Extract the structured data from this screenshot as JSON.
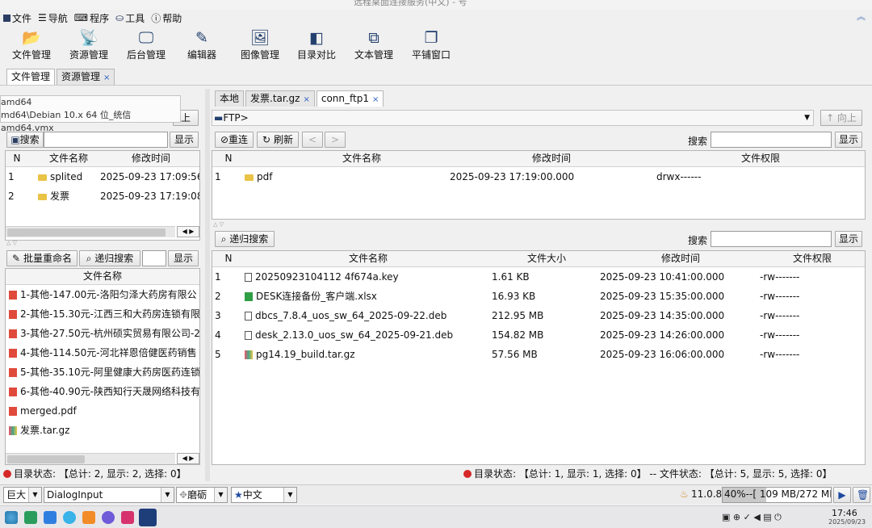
{
  "window": {
    "title": "远程桌面连接服务(中文) - 号"
  },
  "menu": [
    {
      "label": "文件",
      "icon": "document-icon"
    },
    {
      "label": "导航",
      "icon": "menu-lines-icon"
    },
    {
      "label": "程序",
      "icon": "keyboard-icon"
    },
    {
      "label": "工具",
      "icon": "toolbox-icon"
    },
    {
      "label": "帮助",
      "icon": "help-icon"
    }
  ],
  "toolbar": [
    {
      "label": "文件管理",
      "icon": "folder-open-icon"
    },
    {
      "label": "资源管理",
      "icon": "satellite-icon"
    },
    {
      "label": "后台管理",
      "icon": "monitor-icon"
    },
    {
      "label": "编辑器",
      "icon": "edit-icon"
    },
    {
      "label": "图像管理",
      "icon": "image-icon"
    },
    {
      "label": "目录对比",
      "icon": "compare-icon"
    },
    {
      "label": "文本管理",
      "icon": "copy-icon"
    },
    {
      "label": "平铺窗口",
      "icon": "windows-icon"
    }
  ],
  "top_tabs": [
    {
      "label": "文件管理",
      "closable": false
    },
    {
      "label": "资源管理",
      "closable": true,
      "close": "×"
    }
  ],
  "tooltip": {
    "line1": "amd64",
    "line2": "md64\\Debian 10.x 64 位_统信amd64.vmx"
  },
  "left": {
    "up_label": "上",
    "search_btn": "搜索",
    "show_btn": "显示",
    "columns": [
      "N",
      "文件名称",
      "修改时间"
    ],
    "rows": [
      {
        "n": "1",
        "name": "splited",
        "time": "2025-09-23 17:09:56.8"
      },
      {
        "n": "2",
        "name": "发票",
        "time": "2025-09-23 17:19:08.8"
      }
    ],
    "scroll_arrows": "◀ ▶",
    "bulk_rename": "批量重命名",
    "recursive_search": "递归搜索",
    "show_btn2": "显示",
    "column2": "文件名称",
    "files": [
      {
        "name": "1-其他-147.00元-洛阳匀泽大药房有限公",
        "type": "pdf"
      },
      {
        "name": "2-其他-15.30元-江西三和大药房连锁有限",
        "type": "pdf"
      },
      {
        "name": "3-其他-27.50元-杭州硕实贸易有限公司-2",
        "type": "pdf"
      },
      {
        "name": "4-其他-114.50元-河北祥恩倍健医药销售",
        "type": "pdf"
      },
      {
        "name": "5-其他-35.10元-阿里健康大药房医药连锁",
        "type": "pdf"
      },
      {
        "name": "6-其他-40.90元-陕西知行天晟网络科技有",
        "type": "pdf"
      },
      {
        "name": "merged.pdf",
        "type": "pdf"
      },
      {
        "name": "发票.tar.gz",
        "type": "archive"
      }
    ],
    "status": "目录状态: 【总计: 2, 显示: 2, 选择: 0】"
  },
  "right_tabs": [
    {
      "label": "本地",
      "closable": false
    },
    {
      "label": "发票.tar.gz",
      "closable": true,
      "close": "×"
    },
    {
      "label": "conn_ftp1",
      "closable": true,
      "close": "×"
    }
  ],
  "right": {
    "path": "FTP>",
    "up_btn": "↑ 向上",
    "reconnect": "重连",
    "refresh": "刷新",
    "search_label": "搜索",
    "show_btn": "显示",
    "columns": [
      "N",
      "文件名称",
      "修改时间",
      "文件权限"
    ],
    "rows": [
      {
        "n": "1",
        "name": "pdf",
        "time": "2025-09-23 17:19:00.000",
        "perm": "drwx------"
      }
    ],
    "recursive_search": "递归搜索",
    "search_label2": "搜索",
    "show_btn2": "显示",
    "columns2": [
      "N",
      "文件名称",
      "文件大小",
      "修改时间",
      "文件权限"
    ],
    "files": [
      {
        "n": "1",
        "name": "20250923104112 4f674a.key",
        "size": "1.61 KB",
        "time": "2025-09-23 10:41:00.000",
        "perm": "-rw-------",
        "type": "file"
      },
      {
        "n": "2",
        "name": "DESK连接备份_客户端.xlsx",
        "size": "16.93 KB",
        "time": "2025-09-23 15:35:00.000",
        "perm": "-rw-------",
        "type": "xls"
      },
      {
        "n": "3",
        "name": "dbcs_7.8.4_uos_sw_64_2025-09-22.deb",
        "size": "212.95 MB",
        "time": "2025-09-23 14:35:00.000",
        "perm": "-rw-------",
        "type": "file"
      },
      {
        "n": "4",
        "name": "desk_2.13.0_uos_sw_64_2025-09-21.deb",
        "size": "154.82 MB",
        "time": "2025-09-23 14:26:00.000",
        "perm": "-rw-------",
        "type": "file"
      },
      {
        "n": "5",
        "name": "pg14.19_build.tar.gz",
        "size": "57.56 MB",
        "time": "2025-09-23 16:06:00.000",
        "perm": "-rw-------",
        "type": "archive"
      }
    ],
    "status": "目录状态: 【总计: 1, 显示: 1, 选择: 0】 -- 文件状态: 【总计: 5, 显示: 5, 选择: 0】"
  },
  "bottom": {
    "size": "巨大",
    "font": "DialogInput",
    "theme": "磨砺",
    "lang": "中文",
    "version": "11.0.8",
    "memory": "40%--[ 109 MB/272 MB ]",
    "memory_fraction": 0.4
  },
  "taskbar": {
    "time": "17:46",
    "date": "2025/09/23"
  }
}
